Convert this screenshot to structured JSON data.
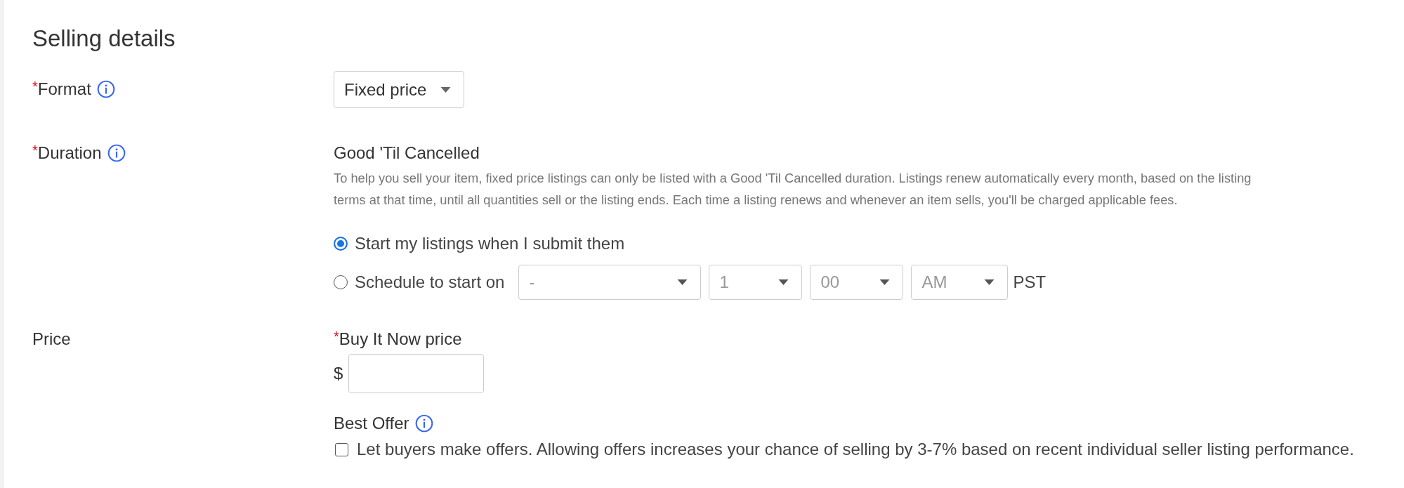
{
  "section_title": "Selling details",
  "format": {
    "label": "Format",
    "required_mark": "*",
    "info": true,
    "value": "Fixed price"
  },
  "duration": {
    "label": "Duration",
    "required_mark": "*",
    "info": true,
    "value": "Good 'Til Cancelled",
    "description": "To help you sell your item, fixed price listings can only be listed with a Good 'Til Cancelled duration. Listings renew automatically every month, based on the listing terms at that time, until all quantities sell or the listing ends. Each time a listing renews and whenever an item sells, you'll be charged applicable fees.",
    "options": [
      {
        "label": "Start my listings when I submit them",
        "selected": true
      },
      {
        "label": "Schedule to start on",
        "selected": false
      }
    ],
    "schedule": {
      "disabled": true,
      "selects": [
        "-",
        "1",
        "00",
        "AM"
      ],
      "timezone": "PST"
    }
  },
  "price": {
    "label": "Price",
    "buy_it_now": {
      "label": "Buy It Now price",
      "required_mark": "*",
      "currency": "$"
    },
    "best_offer": {
      "label": "Best Offer",
      "info": true,
      "checked": false,
      "text": "Let buyers make offers. Allowing offers increases your chance of selling by 3-7% based on recent individual seller listing performance."
    }
  }
}
